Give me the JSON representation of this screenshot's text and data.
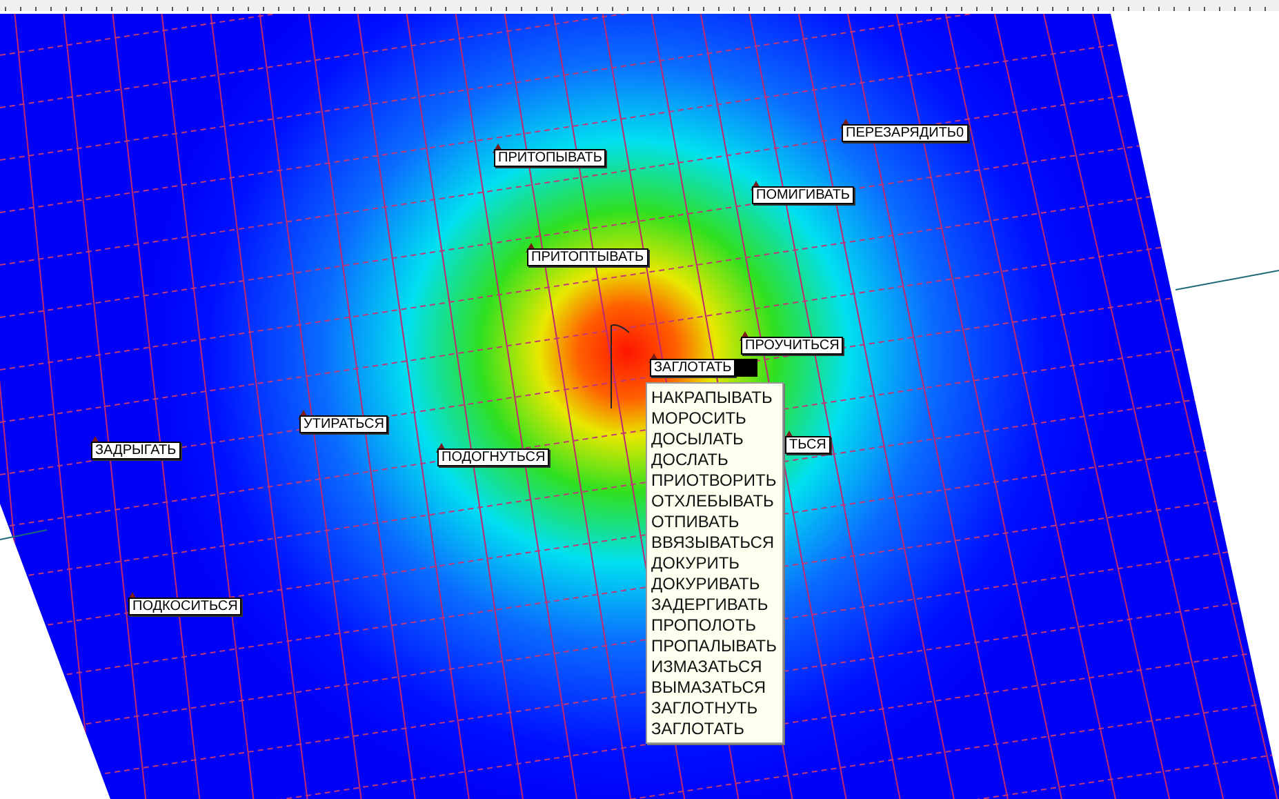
{
  "markers": [
    {
      "label": "ПЕРЕЗАРЯДИТЬ0",
      "kind": "plain"
    },
    {
      "label": "ПРИТОПЫВАТЬ",
      "kind": "plain"
    },
    {
      "label": "ПОМИГИВАТЬ",
      "kind": "plain"
    },
    {
      "label": "ПРИТОПТЫВАТЬ",
      "kind": "plain"
    },
    {
      "label": "ПРОУЧИТЬСЯ",
      "kind": "plain"
    },
    {
      "label": "ЗАГЛОТАТЬ",
      "kind": "active"
    },
    {
      "label": "УТИРАТЬСЯ",
      "kind": "plain"
    },
    {
      "label": "ТЬСЯ",
      "kind": "plain"
    },
    {
      "label": "ЗАДРЫГАТЬ",
      "kind": "plain"
    },
    {
      "label": "ПОДОГНУТЬСЯ",
      "kind": "plain"
    },
    {
      "label": "ПОДКОСИТЬСЯ",
      "kind": "plain"
    }
  ],
  "popup": {
    "items": [
      "НАКРАПЫВАТЬ",
      "МОРОСИТЬ",
      "ДОСЫЛАТЬ",
      "ДОСЛАТЬ",
      "ПРИОТВОРИТЬ",
      "ОТХЛЕБЫВАТЬ",
      "ОТПИВАТЬ",
      "ВВЯЗЫВАТЬСЯ",
      "ДОКУРИТЬ",
      "ДОКУРИВАТЬ",
      "ЗАДЕРГИВАТЬ",
      "ПРОПОЛОТЬ",
      "ПРОПАЛЫВАТЬ",
      "ИЗМАЗАТЬСЯ",
      "ВЫМАЗАТЬСЯ",
      "ЗАГЛОТНУТЬ",
      "ЗАГЛОТАТЬ"
    ]
  }
}
